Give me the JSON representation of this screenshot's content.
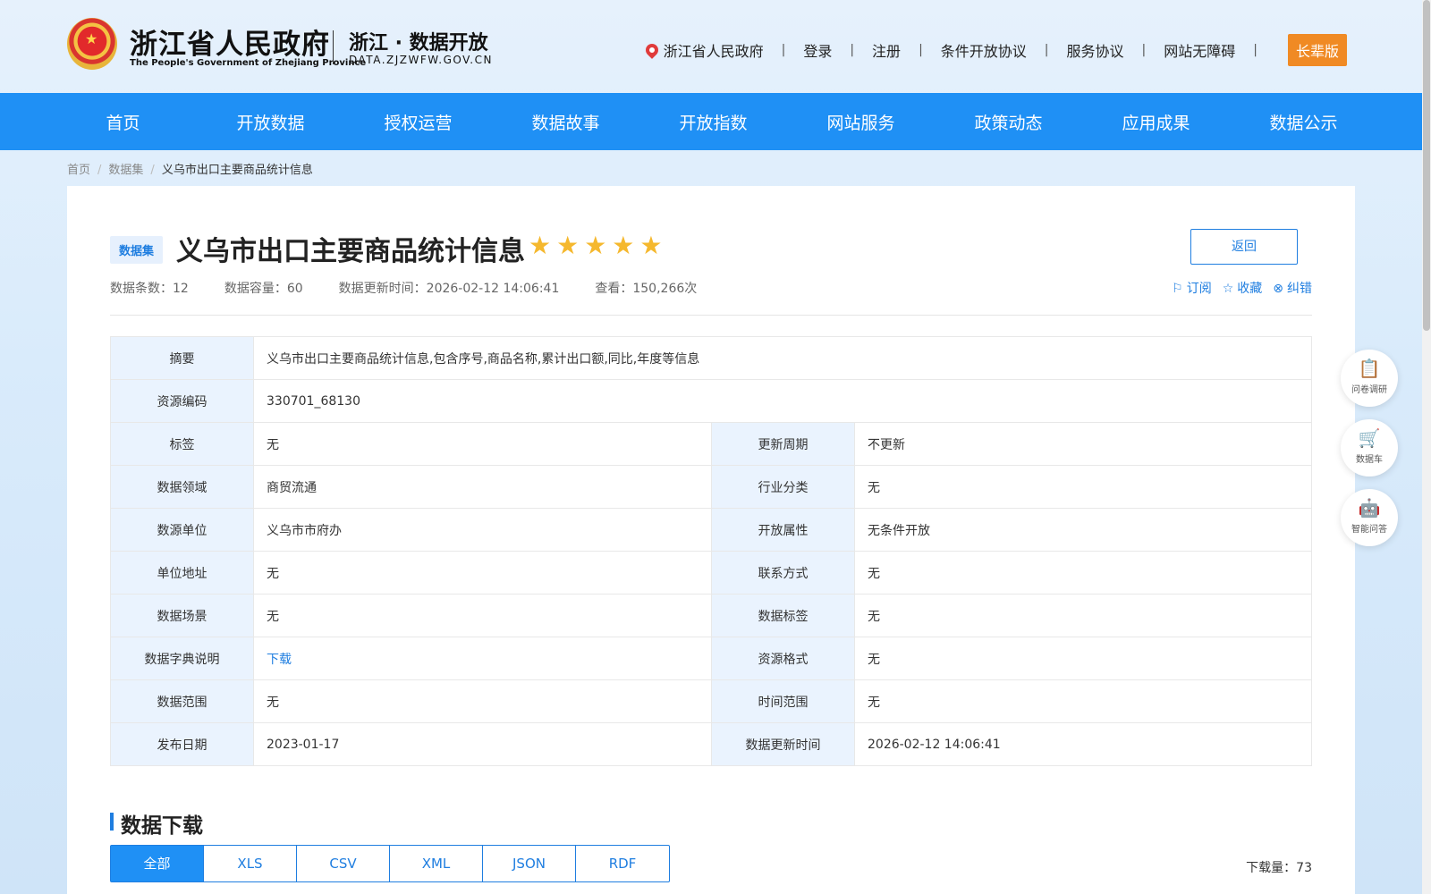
{
  "header": {
    "gov_title": "浙江省人民政府",
    "gov_subtitle": "The People's Government of Zhejiang Province",
    "site_title": "浙江 · 数据开放",
    "site_domain": "DATA.ZJZWFW.GOV.CN",
    "links": {
      "gov_portal": "浙江省人民政府",
      "login": "登录",
      "register": "注册",
      "conditional_agreement": "条件开放协议",
      "service_agreement": "服务协议",
      "accessibility": "网站无障碍",
      "elder_mode": "长辈版"
    }
  },
  "nav": {
    "items": [
      "首页",
      "开放数据",
      "授权运营",
      "数据故事",
      "开放指数",
      "网站服务",
      "政策动态",
      "应用成果",
      "数据公示"
    ]
  },
  "breadcrumb": {
    "home": "首页",
    "datasets": "数据集",
    "current": "义乌市出口主要商品统计信息"
  },
  "dataset": {
    "badge": "数据集",
    "title": "义乌市出口主要商品统计信息",
    "rating": 5,
    "stars": "★★★★★",
    "back_label": "返回",
    "meta": {
      "records_label": "数据条数：",
      "records": "12",
      "capacity_label": "数据容量：",
      "capacity": "60",
      "updated_label": "数据更新时间：",
      "updated": "2026-02-12 14:06:41",
      "views_label": "查看：",
      "views": "150,266次"
    },
    "actions": {
      "subscribe": "订阅",
      "favorite": "收藏",
      "report": "纠错"
    }
  },
  "info": {
    "summary_label": "摘要",
    "summary": "义乌市出口主要商品统计信息,包含序号,商品名称,累计出口额,同比,年度等信息",
    "code_label": "资源编码",
    "code": "330701_68130",
    "rows": [
      {
        "l1": "标签",
        "v1": "无",
        "l2": "更新周期",
        "v2": "不更新"
      },
      {
        "l1": "数据领域",
        "v1": "商贸流通",
        "l2": "行业分类",
        "v2": "无"
      },
      {
        "l1": "数源单位",
        "v1": "义乌市市府办",
        "l2": "开放属性",
        "v2": "无条件开放"
      },
      {
        "l1": "单位地址",
        "v1": "无",
        "l2": "联系方式",
        "v2": "无"
      },
      {
        "l1": "数据场景",
        "v1": "无",
        "l2": "数据标签",
        "v2": "无"
      },
      {
        "l1": "数据字典说明",
        "v1": "下载",
        "l2": "资源格式",
        "v2": "无"
      },
      {
        "l1": "数据范围",
        "v1": "无",
        "l2": "时间范围",
        "v2": "无"
      },
      {
        "l1": "发布日期",
        "v1": "2023-01-17",
        "l2": "数据更新时间",
        "v2": "2026-02-12 14:06:41"
      }
    ]
  },
  "download": {
    "title": "数据下载",
    "tabs": [
      "全部",
      "XLS",
      "CSV",
      "XML",
      "JSON",
      "RDF"
    ],
    "active_tab": "全部",
    "count_label": "下载量：",
    "count": "73"
  },
  "floating": {
    "survey": "问卷调研",
    "cart": "数据车",
    "qa": "智能问答"
  },
  "colors": {
    "nav": "#1f90f5",
    "accent": "#1f7ee0",
    "elder": "#f08a24",
    "star": "#f5b82e"
  }
}
